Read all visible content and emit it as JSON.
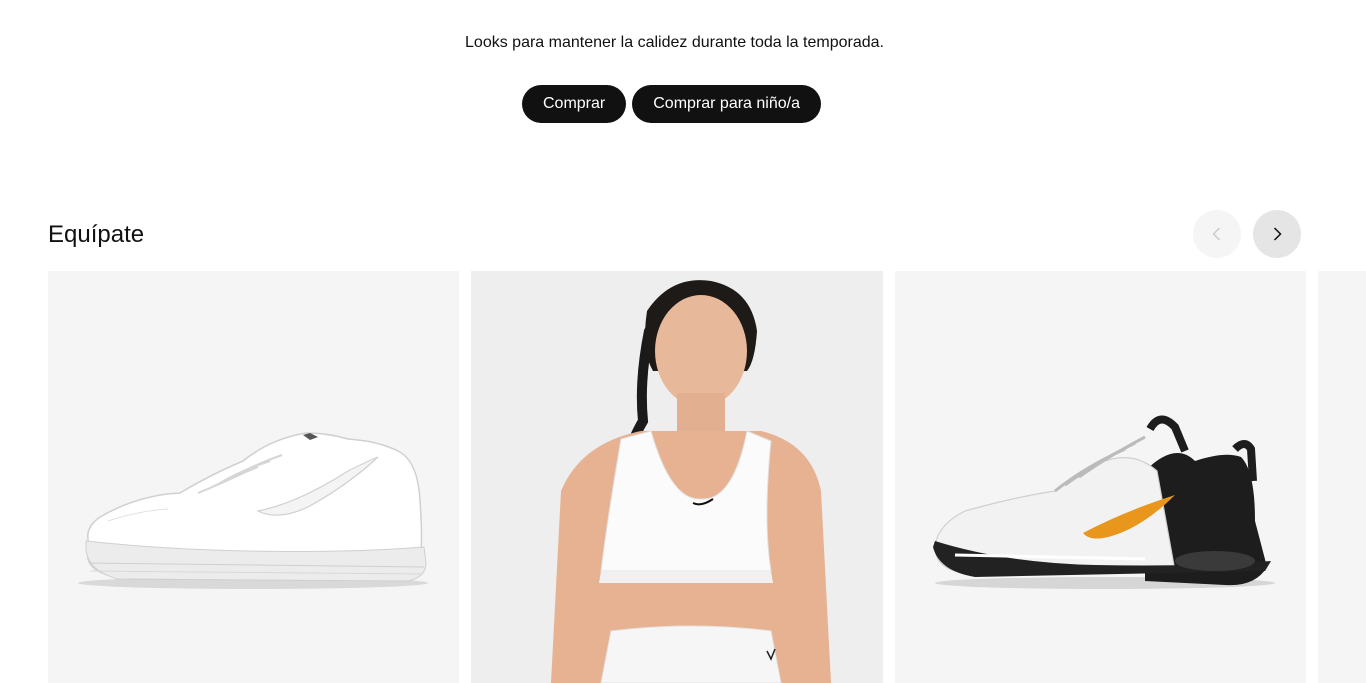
{
  "hero": {
    "subtitle": "Looks para mantener la calidez durante toda la temporada.",
    "buttons": {
      "shop_label": "Comprar",
      "shop_kids_label": "Comprar para niño/a"
    }
  },
  "section": {
    "title": "Equípate",
    "prev_icon": "chevron-left-icon",
    "next_icon": "chevron-right-icon"
  },
  "products": [
    {
      "image": "white-sneaker-image"
    },
    {
      "image": "white-sports-bra-image"
    },
    {
      "image": "training-shoe-image",
      "accent_color": "#e8961c"
    },
    {
      "image": "partial-product-image"
    }
  ],
  "colors": {
    "button_bg": "#111111",
    "button_text": "#ffffff",
    "card_bg": "#f5f5f5"
  }
}
